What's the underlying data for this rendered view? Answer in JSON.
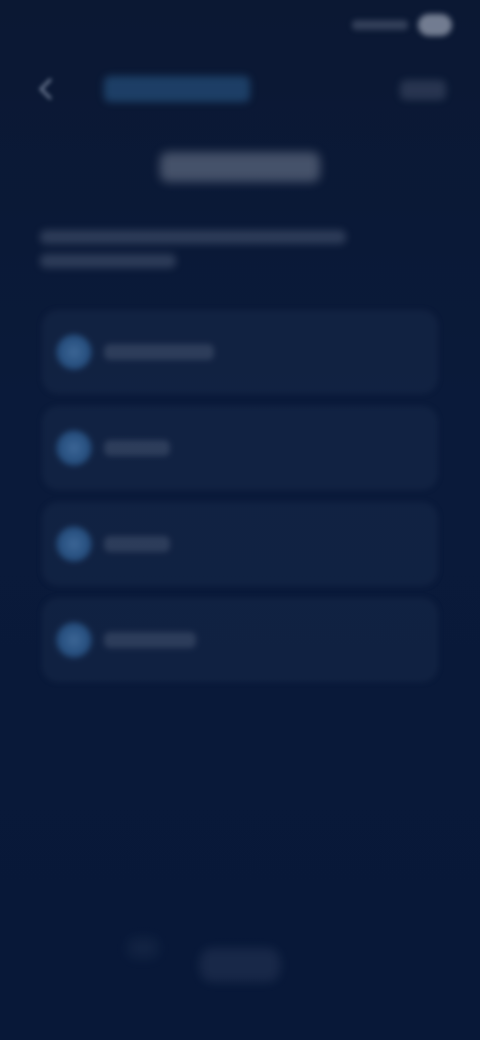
{
  "status_bar": {
    "time": "",
    "signal_icon": "signal-icon",
    "battery_icon": "battery-icon"
  },
  "top_nav": {
    "back_icon": "chevron-left-icon",
    "link_label": "",
    "right_label": ""
  },
  "page": {
    "title": "",
    "description": [
      "",
      ""
    ]
  },
  "list": {
    "items": [
      {
        "icon": "circle-icon",
        "label": ""
      },
      {
        "icon": "circle-icon",
        "label": ""
      },
      {
        "icon": "circle-icon",
        "label": ""
      },
      {
        "icon": "circle-icon",
        "label": ""
      }
    ]
  },
  "bottom": {
    "button_label": ""
  },
  "colors": {
    "background": "#0a1a3a",
    "accent": "#3f86c2",
    "text": "#c7d2e6"
  }
}
